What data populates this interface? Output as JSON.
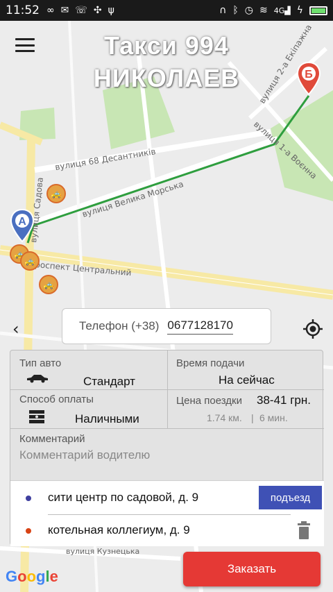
{
  "status_bar": {
    "time": "11:52",
    "left_icons": [
      "infinity-icon",
      "messenger-icon",
      "viber-icon",
      "fan-icon",
      "usb-icon"
    ],
    "right_icons": [
      "headset-icon",
      "bluetooth-icon",
      "alarm-icon",
      "wifi-icon",
      "signal-icon",
      "charging-icon",
      "battery-icon"
    ],
    "network_label": "4G"
  },
  "header": {
    "title_line1": "Такси 994",
    "title_line2": "НИКОЛАЕВ"
  },
  "map": {
    "streets": [
      "вулиця 68 Десантників",
      "вулиця Велика Морська",
      "вулиця Садова",
      "роспект Центральний",
      "вулиця 2-а Екіпажна",
      "вулиця 1-а Воєнна",
      "вулиця Кузнецька"
    ],
    "pin_a_label": "A",
    "pin_b_label": "Б",
    "route_color": "#2e9e3e",
    "google_logo": "Google"
  },
  "phone": {
    "label": "Телефон (+38)",
    "value": "0677128170"
  },
  "order_form": {
    "car_type_label": "Тип авто",
    "car_type_value": "Стандарт",
    "pickup_time_label": "Время подачи",
    "pickup_time_value": "На сейчас",
    "payment_label": "Способ оплаты",
    "payment_value": "Наличными",
    "price_label": "Цена поездки",
    "price_value": "38-41 грн.",
    "distance": "1.74 км.",
    "separator": "|",
    "duration": "6 мин.",
    "comment_label": "Комментарий",
    "comment_placeholder": "Комментарий водителю"
  },
  "addresses": {
    "from": "сити центр по садовой, д. 9",
    "to": "котельная коллегиум, д. 9",
    "entrance_button": "подъезд",
    "from_dot_color": "#3f3f9f",
    "to_dot_color": "#d84315"
  },
  "order_button": "Заказать"
}
